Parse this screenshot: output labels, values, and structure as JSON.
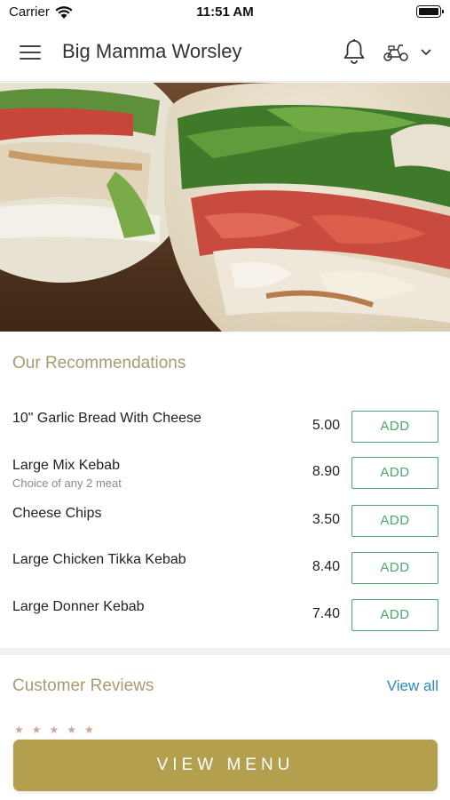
{
  "status_bar": {
    "carrier": "Carrier",
    "time": "11:51 AM"
  },
  "nav": {
    "title": "Big Mamma Worsley"
  },
  "hero": {
    "icon": "wrap-food-photo"
  },
  "recommendations": {
    "title": "Our Recommendations",
    "items": [
      {
        "name": "10\" Garlic Bread With Cheese",
        "subtitle": "",
        "price": "5.00",
        "add_label": "ADD"
      },
      {
        "name": "Large Mix Kebab",
        "subtitle": "Choice of any 2 meat",
        "price": "8.90",
        "add_label": "ADD"
      },
      {
        "name": "Cheese Chips",
        "subtitle": "",
        "price": "3.50",
        "add_label": "ADD"
      },
      {
        "name": "Large Chicken Tikka Kebab",
        "subtitle": "",
        "price": "8.40",
        "add_label": "ADD"
      },
      {
        "name": "Large Donner Kebab",
        "subtitle": "",
        "price": "7.40",
        "add_label": "ADD"
      }
    ]
  },
  "reviews": {
    "title": "Customer Reviews",
    "view_all_label": "View all",
    "stars": "★★★★★"
  },
  "footer": {
    "view_menu_label": "VIEW MENU"
  },
  "colors": {
    "accent_gold": "#b39f4d",
    "section_title": "#a89b72",
    "add_green": "#4aa86d",
    "link_blue": "#2a8ab8"
  }
}
